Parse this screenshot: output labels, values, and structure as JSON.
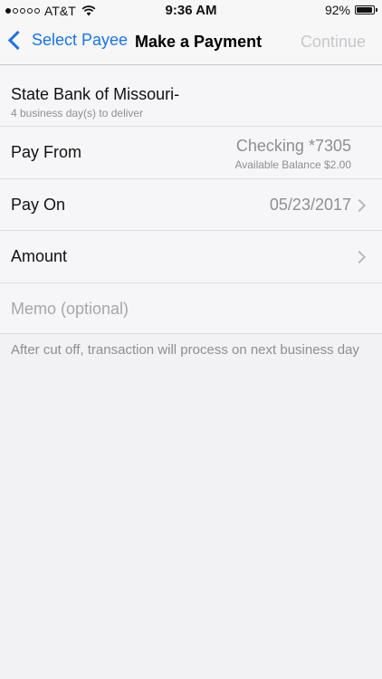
{
  "status": {
    "carrier": "AT&T",
    "time": "9:36 AM",
    "battery_text": "92%",
    "battery_level": 0.92,
    "signal_filled": 1,
    "signal_total": 5
  },
  "nav": {
    "back_label": "Select Payee",
    "title": "Make a Payment",
    "continue_label": "Continue"
  },
  "payee": {
    "name": "State Bank of Missouri-",
    "delivery": "4 business day(s) to deliver"
  },
  "rows": {
    "pay_from": {
      "label": "Pay From",
      "value": "Checking *7305",
      "sub": "Available Balance $2.00"
    },
    "pay_on": {
      "label": "Pay On",
      "value": "05/23/2017"
    },
    "amount": {
      "label": "Amount",
      "value": ""
    },
    "memo": {
      "placeholder": "Memo (optional)"
    }
  },
  "footnote": "After cut off, transaction will process on next business day",
  "colors": {
    "accent": "#1a73e8",
    "disabled": "#c7c7cc",
    "secondary_text": "#8e8e93"
  }
}
